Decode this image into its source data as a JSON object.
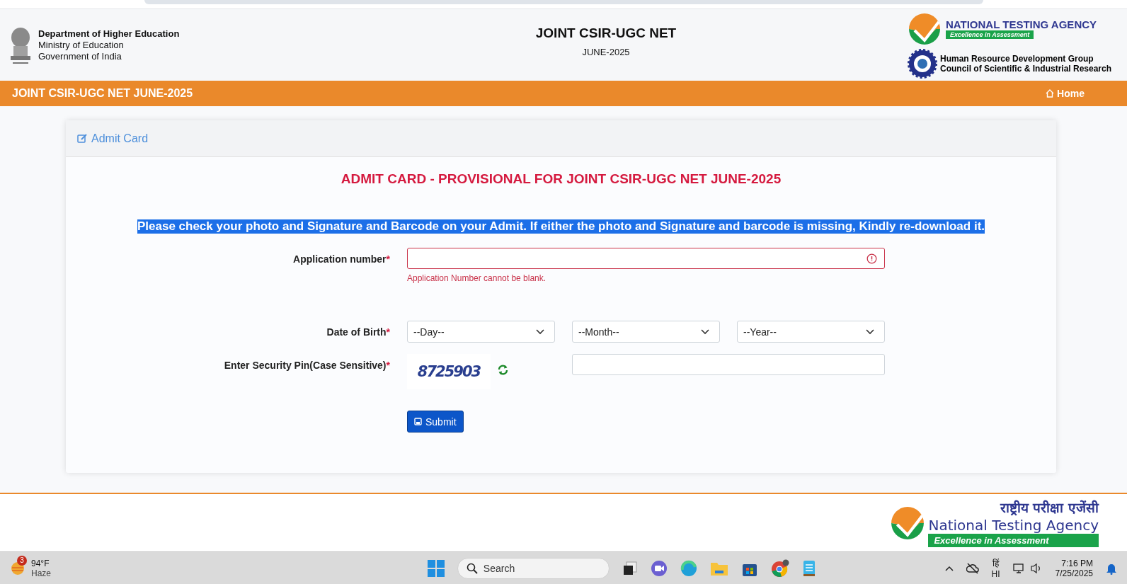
{
  "header": {
    "department": "Department of Higher Education",
    "ministry": "Ministry of Education",
    "government": "Government of India",
    "title": "JOINT CSIR-UGC NET",
    "subtitle": "JUNE-2025",
    "nta_name": "NATIONAL TESTING AGENCY",
    "nta_tagline": "Excellence in Assessment",
    "csir_line1": "Human Resource Development Group",
    "csir_line2": "Council of Scientific & Industrial Research"
  },
  "navbar": {
    "title": "JOINT CSIR-UGC NET JUNE-2025",
    "home": "Home"
  },
  "card": {
    "header": "Admit Card",
    "heading": "ADMIT CARD - PROVISIONAL FOR JOINT CSIR-UGC NET JUNE-2025",
    "notice": {
      "text": "Please check your photo and Signature and Barcode on your Admit. If either the photo and Signature and barcode is missing, Kindly re-download it.",
      "highlighted": true
    },
    "application": {
      "label": "Application number",
      "required_mark": "*",
      "invalid": true,
      "error": "Application Number cannot be blank."
    },
    "dob": {
      "label": "Date of Birth",
      "required_mark": "*",
      "selects": [
        "--Day--",
        "--Month--",
        "--Year--"
      ]
    },
    "pin": {
      "label": "Enter Security Pin(Case Sensitive)",
      "required_mark": "*",
      "captcha": "8725903"
    },
    "submit": "Submit"
  },
  "footer": {
    "hindi": "राष्ट्रीय परीक्षा एजेंसी",
    "english": "National Testing Agency",
    "tagline": "Excellence in Assessment"
  },
  "taskbar": {
    "weather_badge": "3",
    "temperature": "94°F",
    "condition": "Haze",
    "search": "Search",
    "language_top": "हिं",
    "language": "HI",
    "time": "7:16 PM",
    "date": "7/25/2025"
  }
}
